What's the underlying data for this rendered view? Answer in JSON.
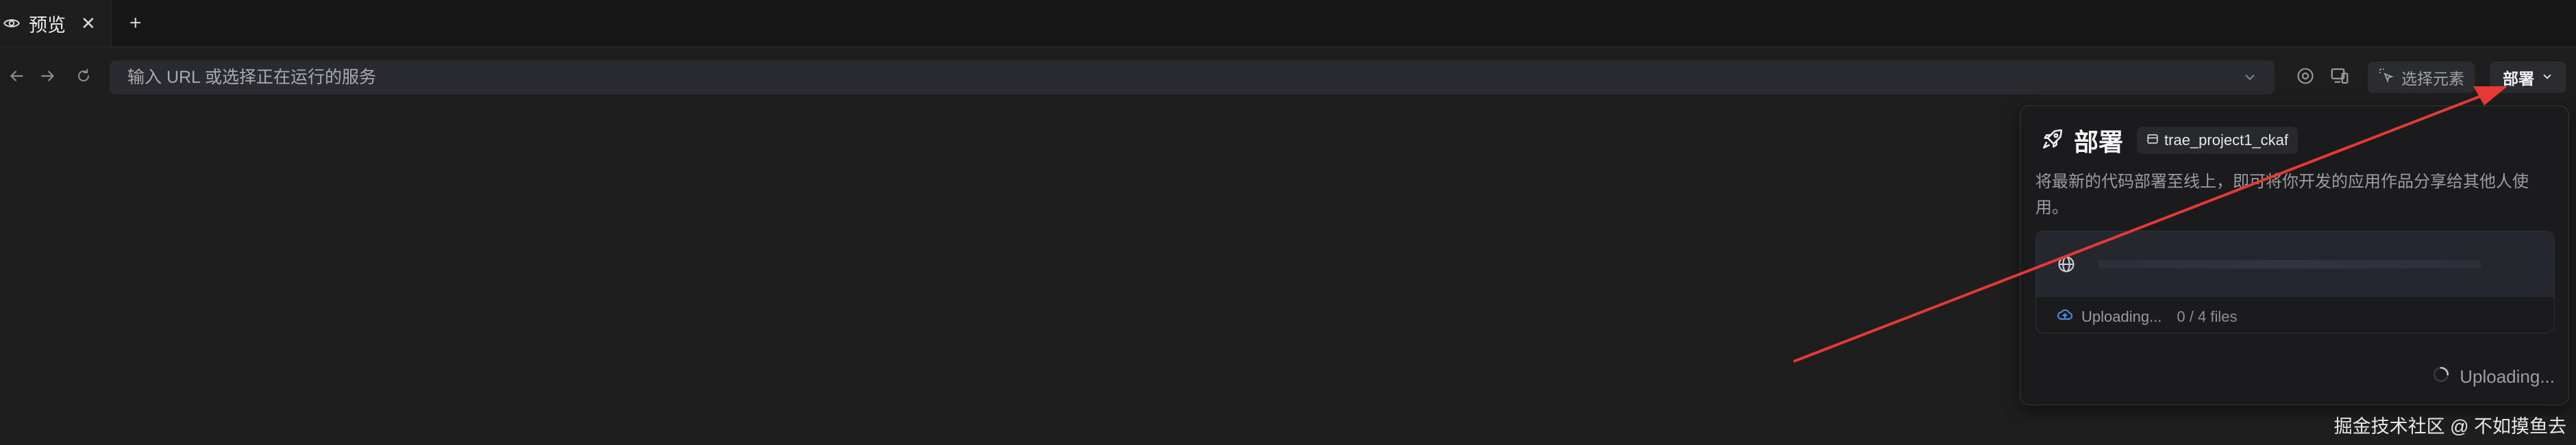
{
  "tab": {
    "label": "预览",
    "close_glyph": "✕",
    "add_glyph": "+"
  },
  "toolbar": {
    "back_icon": "arrow-left-icon",
    "forward_icon": "arrow-right-icon",
    "refresh_icon": "refresh-icon",
    "url_placeholder": "输入 URL 或选择正在运行的服务",
    "url_value": "",
    "select_element_label": "选择元素",
    "deploy_label": "部署"
  },
  "panel": {
    "title": "部署",
    "project_name": "trae_project1_ckaf",
    "description": "将最新的代码部署至线上，即可将你开发的应用作品分享给其他人使用。",
    "upload_status": "Uploading...",
    "upload_count": "0 / 4 files",
    "button_label": "Uploading..."
  },
  "watermark": "掘金技术社区 @ 不如摸鱼去",
  "colors": {
    "annotation_arrow": "#e53935",
    "upload_cloud": "#4a8fe0"
  }
}
